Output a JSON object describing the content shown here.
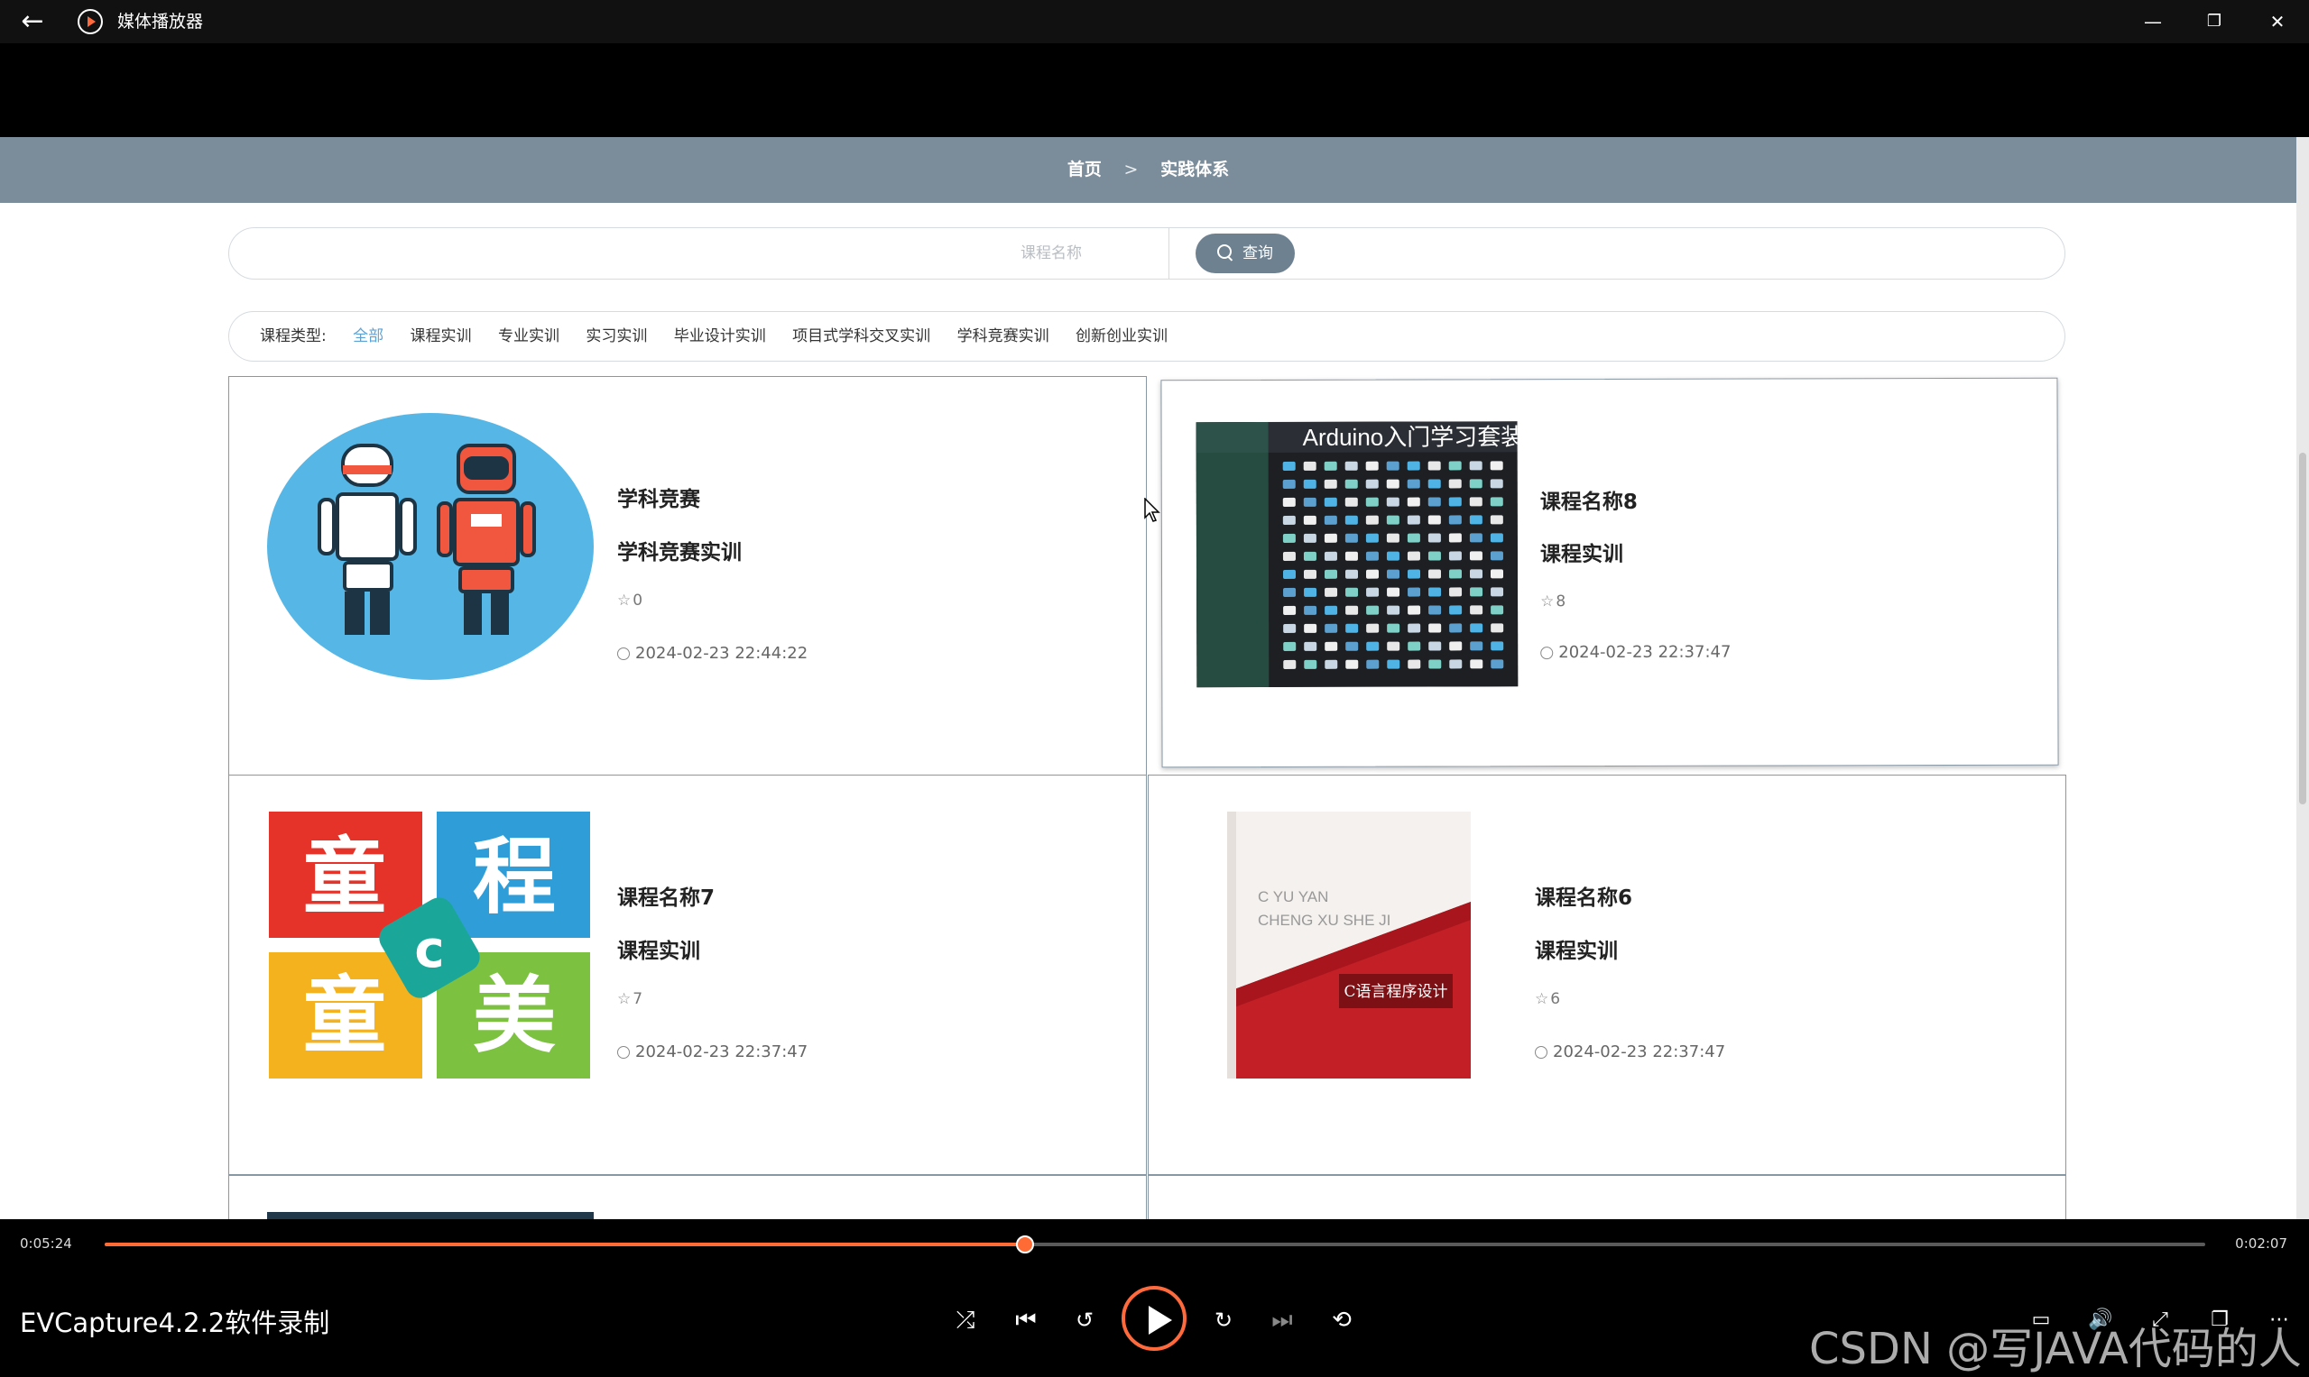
{
  "window": {
    "title": "媒体播放器",
    "back_icon": "←",
    "minimize_icon": "—",
    "restore_icon": "❐",
    "close_icon": "✕"
  },
  "page": {
    "breadcrumb": {
      "home": "首页",
      "separator": ">",
      "current": "实践体系"
    },
    "search": {
      "placeholder": "课程名称",
      "value": "",
      "button_label": "查询"
    },
    "filter": {
      "label": "课程类型:",
      "options": [
        "全部",
        "课程实训",
        "专业实训",
        "实习实训",
        "毕业设计实训",
        "项目式学科交叉实训",
        "学科竞赛实训",
        "创新创业实训"
      ],
      "active_index": 0
    },
    "courses": [
      {
        "name": "学科竞赛",
        "type": "学科竞赛实训",
        "likes": "0",
        "time": "2024-02-23 22:44:22",
        "image": "robots-illustration"
      },
      {
        "name": "课程名称8",
        "type": "课程实训",
        "likes": "8",
        "time": "2024-02-23 22:37:47",
        "image": "arduino-kit-photo",
        "image_text": "Arduino入门学习套装"
      },
      {
        "name": "课程名称7",
        "type": "课程实训",
        "likes": "7",
        "time": "2024-02-23 22:37:47",
        "image": "tongcheng-logo",
        "image_text": {
          "a": "童",
          "b": "程",
          "c": "童",
          "d": "美"
        }
      },
      {
        "name": "课程名称6",
        "type": "课程实训",
        "likes": "6",
        "time": "2024-02-23 22:37:47",
        "image": "c-programming-book",
        "image_text": {
          "line1": "C YU YAN",
          "line2": "CHENG XU SHE JI",
          "title": "C语言程序设计"
        }
      }
    ]
  },
  "player": {
    "current_time": "0:05:24",
    "duration": "0:02:07",
    "progress": 0.438,
    "recording_label": "EVCapture4.2.2软件录制",
    "accent_color": "#ff6b35",
    "watermark": "CSDN @写JAVA代码的人"
  }
}
